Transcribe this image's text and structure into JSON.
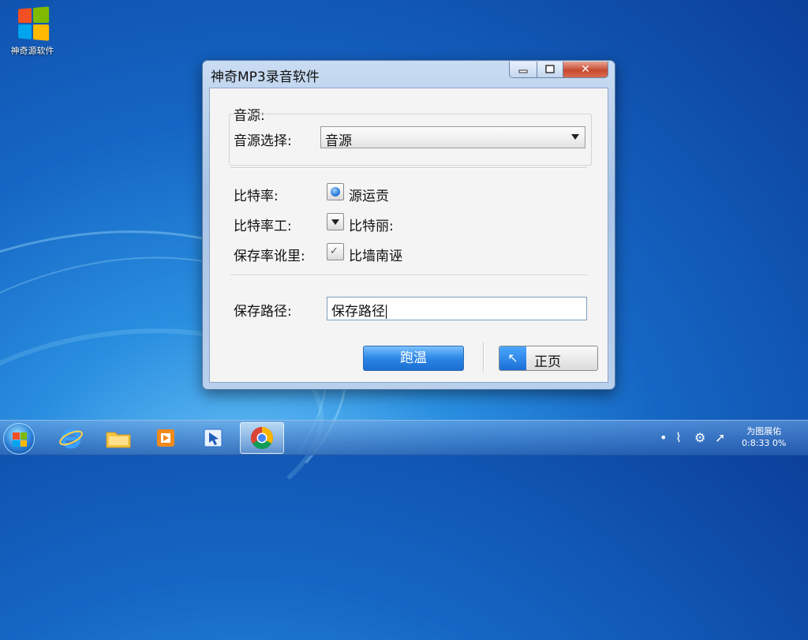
{
  "desktop": {
    "icons": [
      {
        "label": "神奇源软件",
        "icon": "windows-logo-icon"
      }
    ]
  },
  "window": {
    "title": "神奇MP3录音软件",
    "controls": {
      "minimize": "–",
      "maximize": "□",
      "close": "✕"
    }
  },
  "form": {
    "source_group_label": "音源:",
    "source_select_label": "音源选择:",
    "source_select_value": "音源",
    "bitrate_label": "比特率:",
    "bitrate_option_label": "源运贡",
    "bitrate_mode_label": "比特率⼯:",
    "bitrate_mode_option_label": "比特丽:",
    "save_rate_label": "保存率讹里:",
    "save_rate_option_label": "比墙南诬",
    "save_path_label": "保存路径:",
    "save_path_value": "保存路径"
  },
  "buttons": {
    "ok_label": "跑温",
    "cancel_label": "正页"
  },
  "taskbar": {
    "apps": [
      "internet-explorer-icon",
      "folder-icon",
      "media-player-icon",
      "arrow-app-icon",
      "chrome-icon"
    ],
    "tray_icons": [
      "dot-icon",
      "network-icon",
      "settings-icon",
      "upload-arrow-icon"
    ],
    "clock_line1": "为图展佑",
    "clock_line2": "0:8:33 0%"
  },
  "colors": {
    "accent": "#1b6fd2",
    "close_red": "#c74a30",
    "desktop_blue": "#1566c4"
  }
}
